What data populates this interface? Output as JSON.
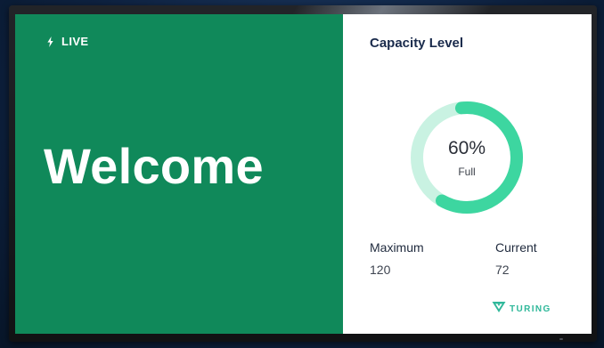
{
  "left": {
    "badge_label": "LIVE",
    "headline": "Welcome",
    "background": "#10895a"
  },
  "capacity": {
    "title": "Capacity Level",
    "percent": 60,
    "percent_label": "60%",
    "status_label": "Full",
    "gauge_color": "#3dd6a0",
    "gauge_track_color": "#c9f2e2",
    "maximum_label": "Maximum",
    "maximum_value": "120",
    "current_label": "Current",
    "current_value": "72"
  },
  "brand": {
    "name": "TURING",
    "color": "#2fb89a"
  },
  "icons": {
    "badge_icon": "lightning-bolt-icon",
    "brand_icon": "turing-logo-icon"
  }
}
